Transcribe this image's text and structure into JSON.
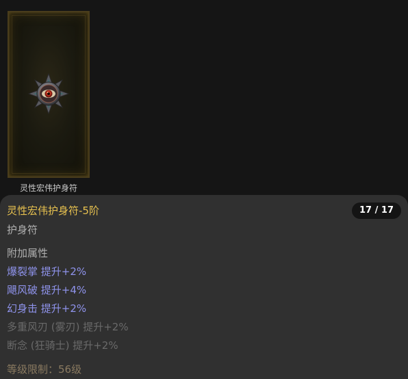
{
  "item": {
    "name": "灵性宏伟护身符",
    "icon": "amulet-icon",
    "colors": {
      "gem": "#c0331c",
      "metal": "#7a7a80",
      "frame": "#4a3d1c"
    }
  },
  "tooltip": {
    "title": "灵性宏伟护身符-5阶",
    "count": "17 / 17",
    "type": "护身符",
    "section_label": "附加属性",
    "attributes": [
      {
        "text": "爆裂掌 提升+2%",
        "state": "active"
      },
      {
        "text": "飓风破 提升+4%",
        "state": "active"
      },
      {
        "text": "幻身击 提升+2%",
        "state": "active"
      },
      {
        "text": "多重风刃 (雾刃) 提升+2%",
        "state": "inactive"
      },
      {
        "text": "断念 (狂骑士) 提升+2%",
        "state": "inactive"
      }
    ],
    "requirement": "等级限制：56级",
    "colors": {
      "title": "#e7c14f",
      "active_attr": "#8f93ec",
      "inactive_attr": "#6a6a6a",
      "requirement": "#8a7a60",
      "panel_bg": "#303030"
    }
  }
}
